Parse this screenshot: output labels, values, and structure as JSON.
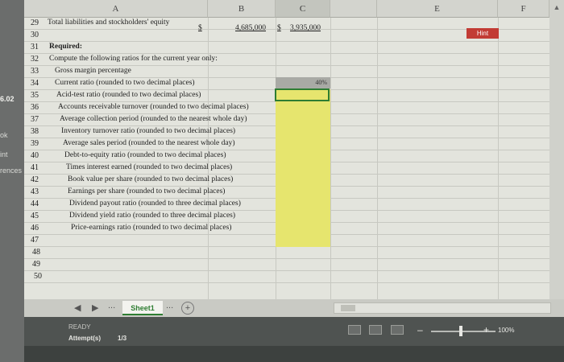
{
  "left_panel": {
    "label_1": "6.02",
    "label_2": "ok",
    "label_3": "int",
    "label_4": "rences"
  },
  "columns": [
    "A",
    "B",
    "C",
    "",
    "E",
    "F"
  ],
  "rows": [
    {
      "num": "29",
      "text": "Total liabilities and stockholders' equity",
      "bold": false
    },
    {
      "num": "30",
      "text": "",
      "bold": false
    },
    {
      "num": "31",
      "text": "Required:",
      "bold": true
    },
    {
      "num": "32",
      "text": "Compute the following ratios for the current year only:",
      "bold": false
    },
    {
      "num": "33",
      "text": "Gross margin percentage",
      "bold": false
    },
    {
      "num": "34",
      "text": "Current ratio (rounded to two decimal places)",
      "bold": false
    },
    {
      "num": "35",
      "text": "Acid-test ratio (rounded to two decimal places)",
      "bold": false
    },
    {
      "num": "36",
      "text": "Accounts receivable turnover (rounded to two decimal places)",
      "bold": false
    },
    {
      "num": "37",
      "text": "Average collection period (rounded to the nearest whole day)",
      "bold": false
    },
    {
      "num": "38",
      "text": "Inventory turnover ratio (rounded to two decimal places)",
      "bold": false
    },
    {
      "num": "39",
      "text": "Average sales period (rounded to the nearest whole day)",
      "bold": false
    },
    {
      "num": "40",
      "text": "Debt-to-equity ratio (rounded to two decimal places)",
      "bold": false
    },
    {
      "num": "41",
      "text": "Times interest earned (rounded to two decimal places)",
      "bold": false
    },
    {
      "num": "42",
      "text": "Book value per share (rounded to two decimal places)",
      "bold": false
    },
    {
      "num": "43",
      "text": "Earnings per share (rounded to two decimal places)",
      "bold": false
    },
    {
      "num": "44",
      "text": "Dividend payout ratio (rounded to three decimal places)",
      "bold": false
    },
    {
      "num": "45",
      "text": "Dividend yield ratio (rounded to three decimal places)",
      "bold": false
    },
    {
      "num": "46",
      "text": "Price-earnings ratio (rounded to two decimal places)",
      "bold": false
    },
    {
      "num": "47",
      "text": "",
      "bold": false
    },
    {
      "num": "48",
      "text": "",
      "bold": false
    },
    {
      "num": "49",
      "text": "",
      "bold": false
    },
    {
      "num": "50",
      "text": "",
      "bold": false
    }
  ],
  "row29": {
    "dollar_b": "$",
    "value_b": "4,685,000",
    "dollar_c": "$",
    "value_c": "3,935,000"
  },
  "c33_value": "40%",
  "tabbar": {
    "sheet_name": "Sheet1",
    "ellipsis": "...",
    "add": "+"
  },
  "status": {
    "ready": "READY",
    "attempts_label": "Attempt(s)",
    "attempts_value": "1/3",
    "zoom": "100%",
    "hint": "Hint"
  },
  "icons": [
    "tab-prev-icon",
    "tab-next-icon",
    "normal-view-icon",
    "page-layout-icon",
    "page-break-icon",
    "zoom-minus-icon",
    "zoom-plus-icon",
    "scroll-up-icon"
  ],
  "colors": {
    "yellow_input": "#e6e56e",
    "active_border": "#2e7d32",
    "hint_button": "#c23b34"
  }
}
